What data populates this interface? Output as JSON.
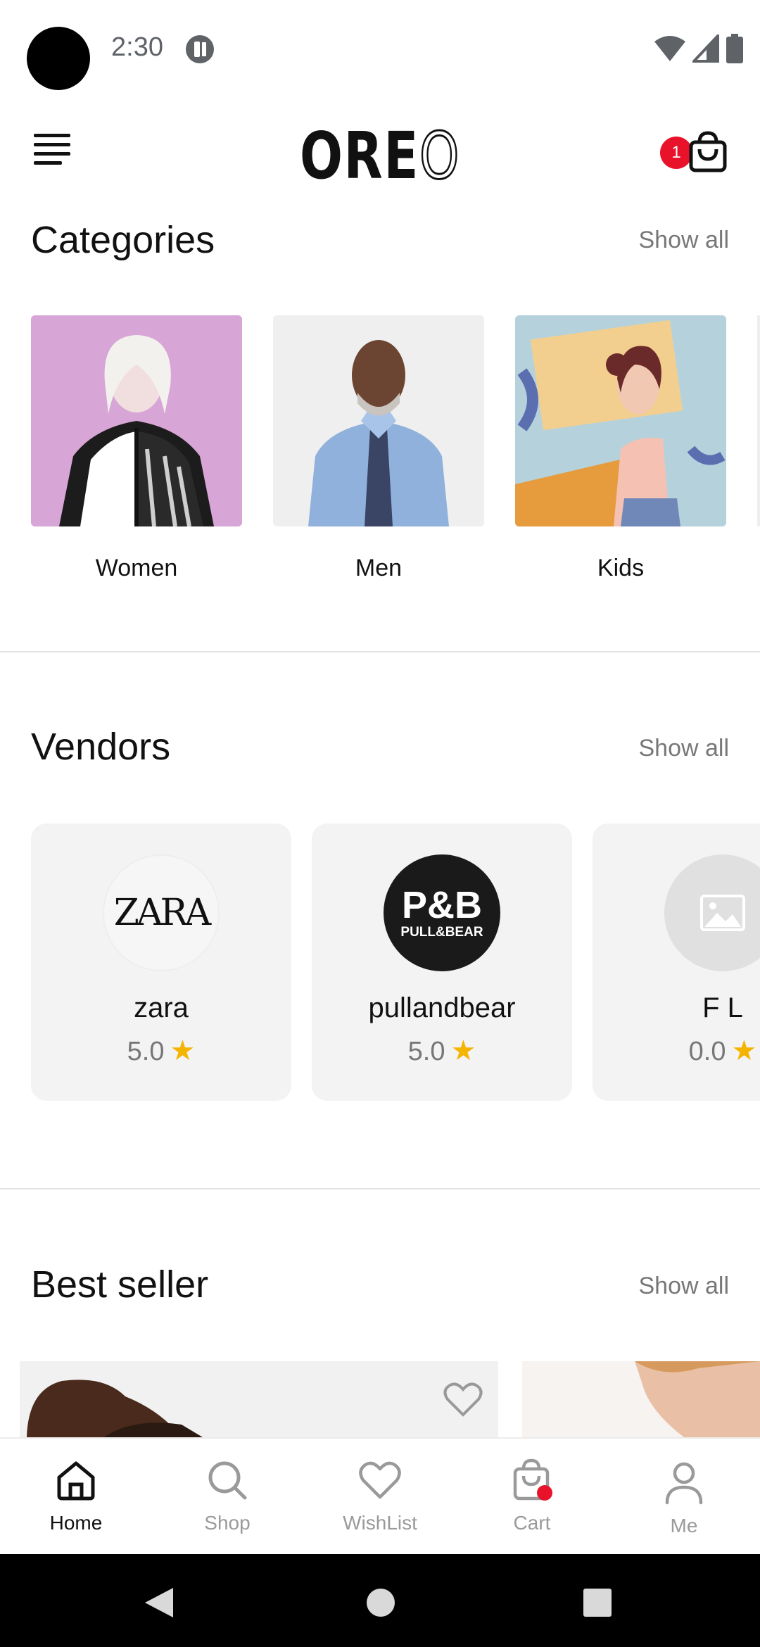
{
  "status_bar": {
    "time": "2:30"
  },
  "header": {
    "logo_main": "ORE",
    "logo_outline": "O",
    "cart_count": "1"
  },
  "categories": {
    "title": "Categories",
    "show_all": "Show all",
    "items": [
      {
        "label": "Women"
      },
      {
        "label": "Men"
      },
      {
        "label": "Kids"
      }
    ]
  },
  "vendors": {
    "title": "Vendors",
    "show_all": "Show all",
    "items": [
      {
        "name": "zara",
        "rating": "5.0",
        "logo_text": "ZARA"
      },
      {
        "name": "pullandbear",
        "rating": "5.0",
        "logo_text": "P&B",
        "logo_subtext": "PULL&BEAR"
      },
      {
        "name": "F L",
        "rating": "0.0"
      }
    ]
  },
  "best_seller": {
    "title": "Best seller",
    "show_all": "Show all"
  },
  "bottom_nav": {
    "items": [
      {
        "label": "Home",
        "icon": "home-icon",
        "active": true
      },
      {
        "label": "Shop",
        "icon": "search-icon"
      },
      {
        "label": "WishList",
        "icon": "heart-icon"
      },
      {
        "label": "Cart",
        "icon": "cart-icon"
      },
      {
        "label": "Me",
        "icon": "person-icon"
      }
    ]
  },
  "colors": {
    "accent_red": "#e8122b",
    "star": "#f5b400",
    "card_bg": "#f3f3f3"
  }
}
